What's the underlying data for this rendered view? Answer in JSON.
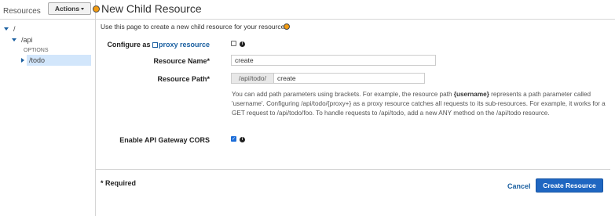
{
  "sidebar": {
    "title": "Resources",
    "actions_label": "Actions",
    "tree": {
      "root": "/",
      "api": "/api",
      "method": "OPTIONS",
      "todo": "/todo"
    }
  },
  "page": {
    "title": "New Child Resource",
    "intro": "Use this page to create a new child resource for your resource."
  },
  "form": {
    "configure_label": "Configure as",
    "proxy_link": "proxy resource",
    "proxy_checked": false,
    "name_label": "Resource Name*",
    "name_value": "create",
    "path_label": "Resource Path*",
    "path_prefix": "/api/todo/",
    "path_value": "create",
    "help_1": "You can add path parameters using brackets. For example, the resource path ",
    "help_param": "{username}",
    "help_2": " represents a path parameter called 'username'. Configuring /api/todo/{proxy+} as a proxy resource catches all requests to its sub-resources. For example, it works for a GET request to /api/todo/foo. To handle requests to /api/todo, add a new ANY method on the /api/todo resource.",
    "cors_label": "Enable API Gateway CORS",
    "cors_checked": true,
    "required_note": "* Required",
    "cancel_label": "Cancel",
    "create_label": "Create Resource"
  },
  "colors": {
    "accent": "#1f66c1",
    "link": "#1a5fa0",
    "highlight": "#d2e6fb",
    "hint_dot": "#f39c12"
  }
}
